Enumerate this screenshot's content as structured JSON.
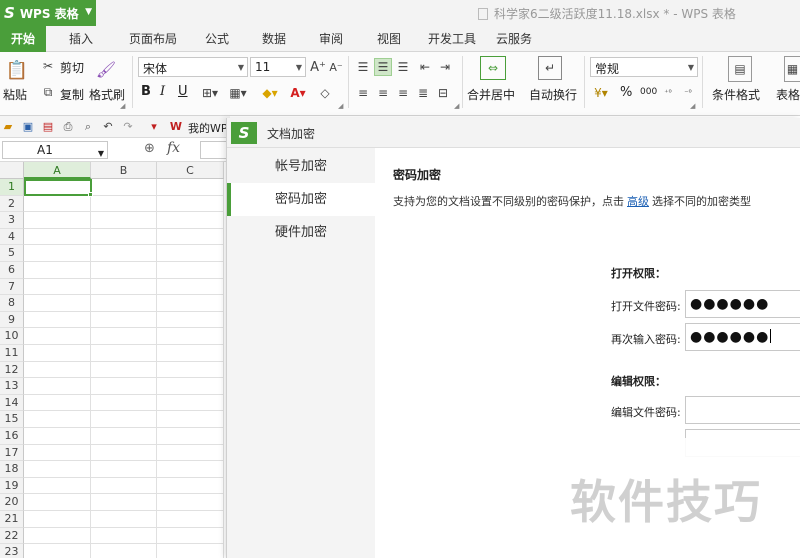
{
  "app": {
    "name": "WPS 表格",
    "logo": "S",
    "accent": "#4a9e3a"
  },
  "window": {
    "doc_title": "科学家6二级活跃度11.18.xlsx * - WPS 表格"
  },
  "menu": {
    "tabs": [
      "开始",
      "插入",
      "页面布局",
      "公式",
      "数据",
      "审阅",
      "视图",
      "开发工具",
      "云服务"
    ],
    "active_tab": "开始"
  },
  "ribbon": {
    "paste": "粘贴",
    "cut": "剪切",
    "copy": "复制",
    "format_painter": "格式刷",
    "font_name": "宋体",
    "font_size": "11",
    "bold": "B",
    "italic": "I",
    "underline": "U",
    "merge_center": "合并居中",
    "wrap_text": "自动换行",
    "number_format": "常规",
    "percent": "%",
    "thousands": "000",
    "conditional_format": "条件格式",
    "table_style": "表格"
  },
  "quickbar": {
    "my_wps": "我的WP"
  },
  "formula_bar": {
    "name_box": "A1",
    "fx": "fx"
  },
  "grid": {
    "columns": [
      "A",
      "B",
      "C"
    ],
    "rows": [
      "1",
      "2",
      "3",
      "4",
      "5",
      "6",
      "7",
      "8",
      "9",
      "10",
      "11",
      "12",
      "13",
      "14",
      "15",
      "16",
      "17",
      "18",
      "19",
      "20",
      "21",
      "22",
      "23"
    ],
    "active_cell": "A1"
  },
  "dialog": {
    "title": "文档加密",
    "nav": [
      "帐号加密",
      "密码加密",
      "硬件加密"
    ],
    "active_nav": "密码加密",
    "section_title": "密码加密",
    "description_before": "支持为您的文档设置不同级别的密码保护，点击",
    "description_link": "高级",
    "description_after": "选择不同的加密类型",
    "open_perm_label": "打开权限：",
    "open_pwd_label": "打开文件密码:",
    "open_pwd_value": "●●●●●●",
    "reenter_pwd_label": "再次输入密码:",
    "reenter_pwd_value": "●●●●●●",
    "edit_perm_label": "编辑权限：",
    "edit_pwd_label": "编辑文件密码:",
    "edit_pwd_value": ""
  },
  "watermark": {
    "text": "软件技巧"
  }
}
